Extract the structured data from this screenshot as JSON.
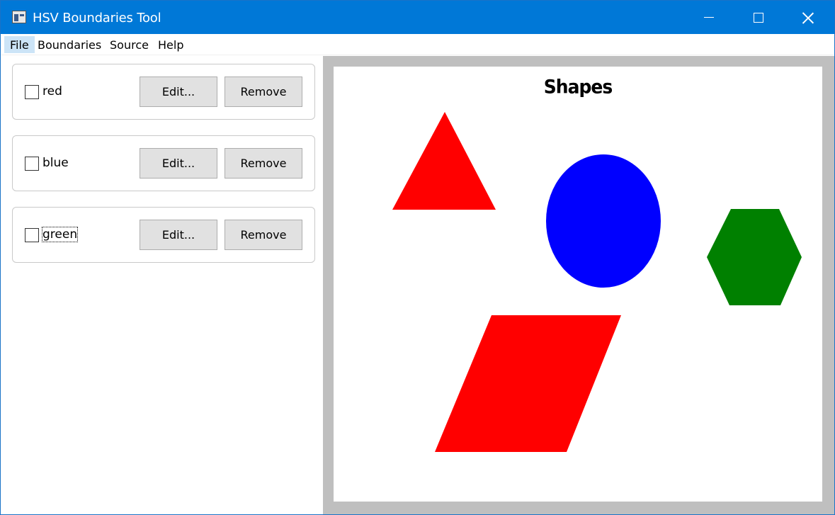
{
  "window": {
    "title": "HSV Boundaries Tool"
  },
  "menu": {
    "file": "File",
    "boundaries": "Boundaries",
    "source": "Source",
    "help": "Help"
  },
  "boundaries": [
    {
      "name": "red",
      "checked": false,
      "edit_label": "Edit...",
      "remove_label": "Remove"
    },
    {
      "name": "blue",
      "checked": false,
      "edit_label": "Edit...",
      "remove_label": "Remove"
    },
    {
      "name": "green",
      "checked": false,
      "edit_label": "Edit...",
      "remove_label": "Remove"
    }
  ],
  "preview": {
    "title": "Shapes",
    "shapes": [
      {
        "kind": "triangle",
        "color": "#ff0000"
      },
      {
        "kind": "ellipse",
        "color": "#0000ff"
      },
      {
        "kind": "hexagon",
        "color": "#008000"
      },
      {
        "kind": "parallelogram",
        "color": "#ff0000"
      }
    ]
  },
  "colors": {
    "titlebar": "#0078d7",
    "menu_highlight": "#cce4f7",
    "button_face": "#e1e1e1",
    "preview_border": "#bfbfbf"
  }
}
